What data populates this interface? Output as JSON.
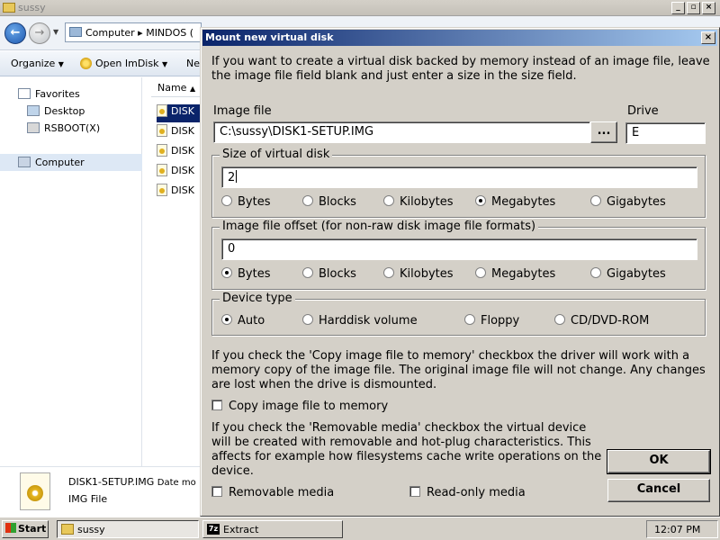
{
  "explorer": {
    "title": "sussy",
    "address": "Computer ▸ MINDOS (",
    "toolbar": {
      "organize": "Organize",
      "open_imdisk": "Open ImDisk",
      "new": "Ne"
    },
    "nav": {
      "favorites": "Favorites",
      "desktop": "Desktop",
      "rsboot": "RSBOOT(X)",
      "computer": "Computer"
    },
    "column_name": "Name",
    "files": [
      "DISK",
      "DISK",
      "DISK",
      "DISK",
      "DISK"
    ],
    "details": {
      "filename": "DISK1-SETUP.IMG",
      "date_label": "Date mo",
      "type": "IMG File"
    }
  },
  "taskbar": {
    "start": "Start",
    "task1": "sussy",
    "task2": "Extract",
    "task2_icon_text": "7z",
    "clock": "12:07 PM"
  },
  "dialog": {
    "title": "Mount new virtual disk",
    "intro": "If you want to create a virtual disk backed by memory instead of an image file, leave the image file field blank and just enter a size in the size field.",
    "image_file_label": "Image file",
    "image_file_value": "C:\\sussy\\DISK1-SETUP.IMG",
    "browse_label": "...",
    "drive_label": "Drive",
    "drive_value": "E",
    "size_group": {
      "legend": "Size of virtual disk",
      "value": "2",
      "units": [
        "Bytes",
        "Blocks",
        "Kilobytes",
        "Megabytes",
        "Gigabytes"
      ],
      "selected": "Megabytes"
    },
    "offset_group": {
      "legend": "Image file offset (for non-raw disk image file formats)",
      "value": "0",
      "units": [
        "Bytes",
        "Blocks",
        "Kilobytes",
        "Megabytes",
        "Gigabytes"
      ],
      "selected": "Bytes"
    },
    "device_group": {
      "legend": "Device type",
      "options": [
        "Auto",
        "Harddisk volume",
        "Floppy",
        "CD/DVD-ROM"
      ],
      "selected": "Auto"
    },
    "copy_info": "If you check the 'Copy image file to memory' checkbox the driver will work with a memory copy of the image file. The original image file will not change. Any changes are lost when the drive is dismounted.",
    "copy_checkbox": {
      "label": "Copy image file to memory",
      "checked": false
    },
    "removable_info": "If you check the 'Removable media' checkbox the virtual device will be created with removable and hot-plug characteristics. This affects for example how filesystems cache write operations on the device.",
    "removable_checkbox": {
      "label": "Removable media",
      "checked": false
    },
    "readonly_checkbox": {
      "label": "Read-only media",
      "checked": false
    },
    "ok_label": "OK",
    "cancel_label": "Cancel"
  }
}
